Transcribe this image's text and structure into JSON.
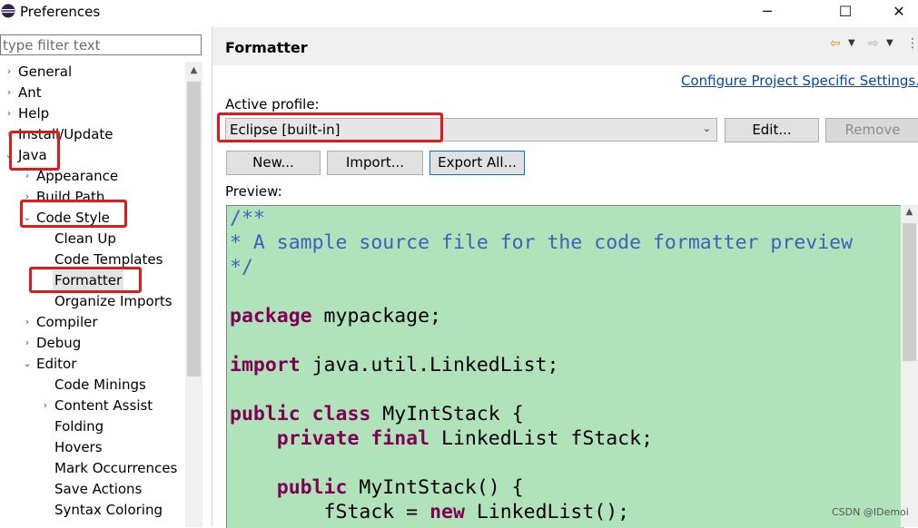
{
  "window": {
    "title": "Preferences",
    "minimize_glyph": "─",
    "maximize_glyph": "☐",
    "close_glyph": "✕"
  },
  "filter": {
    "placeholder": "type filter text"
  },
  "tree": {
    "items": [
      {
        "label": "General",
        "twisty": "›",
        "depth": 0
      },
      {
        "label": "Ant",
        "twisty": "›",
        "depth": 0
      },
      {
        "label": "Help",
        "twisty": "›",
        "depth": 0
      },
      {
        "label": "Install/Update",
        "twisty": "›",
        "depth": 0
      },
      {
        "label": "Java",
        "twisty": "⌄",
        "depth": 0
      },
      {
        "label": "Appearance",
        "twisty": "›",
        "depth": 1
      },
      {
        "label": "Build Path",
        "twisty": "›",
        "depth": 1
      },
      {
        "label": "Code Style",
        "twisty": "⌄",
        "depth": 1
      },
      {
        "label": "Clean Up",
        "twisty": "",
        "depth": 2
      },
      {
        "label": "Code Templates",
        "twisty": "",
        "depth": 2
      },
      {
        "label": "Formatter",
        "twisty": "",
        "depth": 2
      },
      {
        "label": "Organize Imports",
        "twisty": "",
        "depth": 2
      },
      {
        "label": "Compiler",
        "twisty": "›",
        "depth": 1
      },
      {
        "label": "Debug",
        "twisty": "›",
        "depth": 1
      },
      {
        "label": "Editor",
        "twisty": "⌄",
        "depth": 1
      },
      {
        "label": "Code Minings",
        "twisty": "",
        "depth": 2
      },
      {
        "label": "Content Assist",
        "twisty": "›",
        "depth": 2
      },
      {
        "label": "Folding",
        "twisty": "",
        "depth": 2
      },
      {
        "label": "Hovers",
        "twisty": "",
        "depth": 2
      },
      {
        "label": "Mark Occurrences",
        "twisty": "",
        "depth": 2
      },
      {
        "label": "Save Actions",
        "twisty": "",
        "depth": 2
      },
      {
        "label": "Syntax Coloring",
        "twisty": "",
        "depth": 2
      }
    ],
    "selected": "Formatter"
  },
  "page": {
    "title": "Formatter",
    "config_link": "Configure Project Specific Settings...",
    "active_profile_label": "Active profile:",
    "active_profile_value": "Eclipse [built-in]",
    "edit_label": "Edit...",
    "remove_label": "Remove",
    "new_label": "New...",
    "import_label": "Import...",
    "export_label": "Export All...",
    "preview_label": "Preview:"
  },
  "preview_code": [
    [
      [
        "cm",
        "/**"
      ]
    ],
    [
      [
        "cm",
        "* A sample source file for the code formatter preview"
      ]
    ],
    [
      [
        "cm",
        "*/"
      ]
    ],
    [],
    [
      [
        "kw",
        "package"
      ],
      [
        "",
        " mypackage;"
      ]
    ],
    [],
    [
      [
        "kw",
        "import"
      ],
      [
        "",
        " java.util.LinkedList;"
      ]
    ],
    [],
    [
      [
        "kw",
        "public"
      ],
      [
        "",
        " "
      ],
      [
        "kw",
        "class"
      ],
      [
        "",
        " MyIntStack {"
      ]
    ],
    [
      [
        "",
        "    "
      ],
      [
        "kw",
        "private"
      ],
      [
        "",
        " "
      ],
      [
        "kw",
        "final"
      ],
      [
        "",
        " LinkedList fStack;"
      ]
    ],
    [],
    [
      [
        "",
        "    "
      ],
      [
        "kw",
        "public"
      ],
      [
        "",
        " MyIntStack() {"
      ]
    ],
    [
      [
        "",
        "        fStack = "
      ],
      [
        "kw",
        "new"
      ],
      [
        "",
        " LinkedList();"
      ]
    ]
  ],
  "watermark": "CSDN @IDemoi",
  "colors": {
    "preview_background": "#b0e3ba",
    "keyword": "#7f0055",
    "comment": "#3f5fbf",
    "link": "#0645ad",
    "annotation": "#e01a1a"
  }
}
